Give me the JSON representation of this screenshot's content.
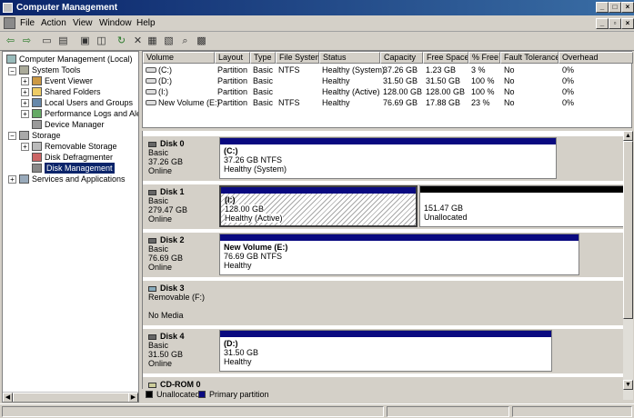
{
  "window": {
    "title": "Computer Management",
    "min": "_",
    "max": "□",
    "close": "×",
    "sub_min": "_",
    "sub_max": "▫",
    "sub_close": "×"
  },
  "menu": [
    "File",
    "Action",
    "View",
    "Window",
    "Help"
  ],
  "tree": {
    "root": "Computer Management (Local)",
    "system_tools": "System Tools",
    "event_viewer": "Event Viewer",
    "shared_folders": "Shared Folders",
    "local_users": "Local Users and Groups",
    "perf_logs": "Performance Logs and Alerts",
    "device_manager": "Device Manager",
    "storage": "Storage",
    "removable": "Removable Storage",
    "defrag": "Disk Defragmenter",
    "disk_mgmt": "Disk Management",
    "services": "Services and Applications"
  },
  "columns": [
    "Volume",
    "Layout",
    "Type",
    "File System",
    "Status",
    "Capacity",
    "Free Space",
    "% Free",
    "Fault Tolerance",
    "Overhead"
  ],
  "volumes": [
    [
      "(C:)",
      "Partition",
      "Basic",
      "NTFS",
      "Healthy (System)",
      "37.26 GB",
      "1.23 GB",
      "3 %",
      "No",
      "0%"
    ],
    [
      "(D:)",
      "Partition",
      "Basic",
      "",
      "Healthy",
      "31.50 GB",
      "31.50 GB",
      "100 %",
      "No",
      "0%"
    ],
    [
      "(I:)",
      "Partition",
      "Basic",
      "",
      "Healthy (Active)",
      "128.00 GB",
      "128.00 GB",
      "100 %",
      "No",
      "0%"
    ],
    [
      "New Volume (E:)",
      "Partition",
      "Basic",
      "NTFS",
      "Healthy",
      "76.69 GB",
      "17.88 GB",
      "23 %",
      "No",
      "0%"
    ]
  ],
  "disks": {
    "d0": {
      "name": "Disk 0",
      "type": "Basic",
      "size": "37.26 GB",
      "state": "Online",
      "p1_name": "(C:)",
      "p1_size": "37.26 GB NTFS",
      "p1_status": "Healthy (System)"
    },
    "d1": {
      "name": "Disk 1",
      "type": "Basic",
      "size": "279.47 GB",
      "state": "Online",
      "p1_name": "(I:)",
      "p1_size": "128.00 GB",
      "p1_status": "Healthy (Active)",
      "p2_size": "151.47 GB",
      "p2_status": "Unallocated"
    },
    "d2": {
      "name": "Disk 2",
      "type": "Basic",
      "size": "76.69 GB",
      "state": "Online",
      "p1_name": "New Volume  (E:)",
      "p1_size": "76.69 GB NTFS",
      "p1_status": "Healthy"
    },
    "d3": {
      "name": "Disk 3",
      "type": "Removable (F:)",
      "state": "No Media"
    },
    "d4": {
      "name": "Disk 4",
      "type": "Basic",
      "size": "31.50 GB",
      "state": "Online",
      "p1_name": "(D:)",
      "p1_size": "31.50 GB",
      "p1_status": "Healthy"
    },
    "cd": {
      "name": "CD-ROM 0"
    }
  },
  "legend": {
    "unallocated": "Unallocated",
    "primary": "Primary partition"
  },
  "colors": {
    "title": "#0a246a",
    "primary": "#0a0a80",
    "unallocated": "#000000"
  }
}
